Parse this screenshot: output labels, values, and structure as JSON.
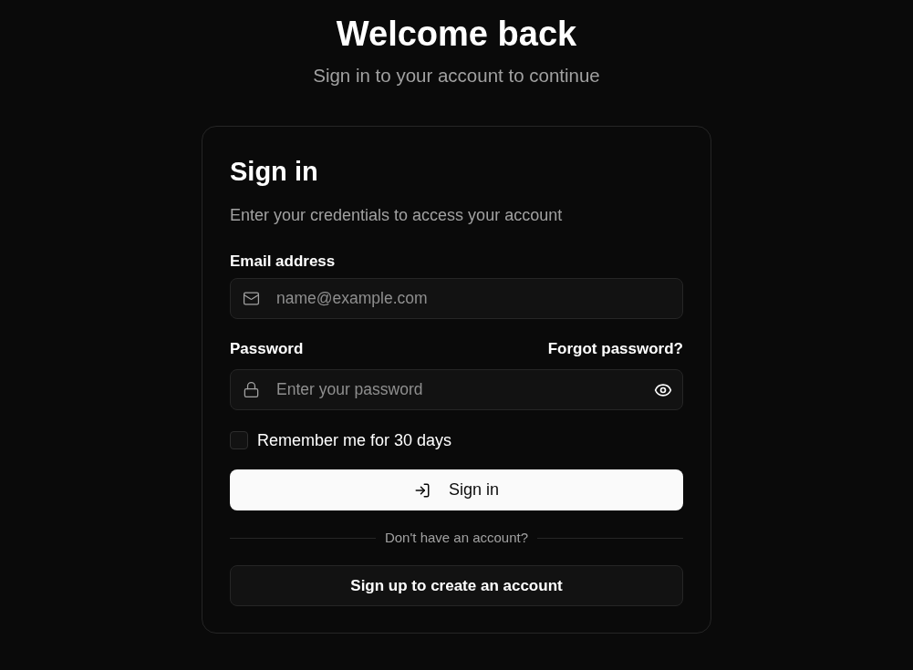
{
  "header": {
    "title": "Welcome back",
    "subtitle": "Sign in to your account to continue"
  },
  "card": {
    "title": "Sign in",
    "description": "Enter your credentials to access your account",
    "fields": [
      {
        "kind": "email",
        "label": "Email address",
        "placeholder": "name@example.com"
      },
      {
        "kind": "password",
        "label": "Password",
        "link": "Forgot password?",
        "placeholder": "Enter your password"
      }
    ],
    "remember": {
      "label": "Remember me for 30 days",
      "checked": false
    },
    "submit": "Sign in",
    "divider": "Don't have an account?",
    "signup": "Sign up to create an account"
  }
}
